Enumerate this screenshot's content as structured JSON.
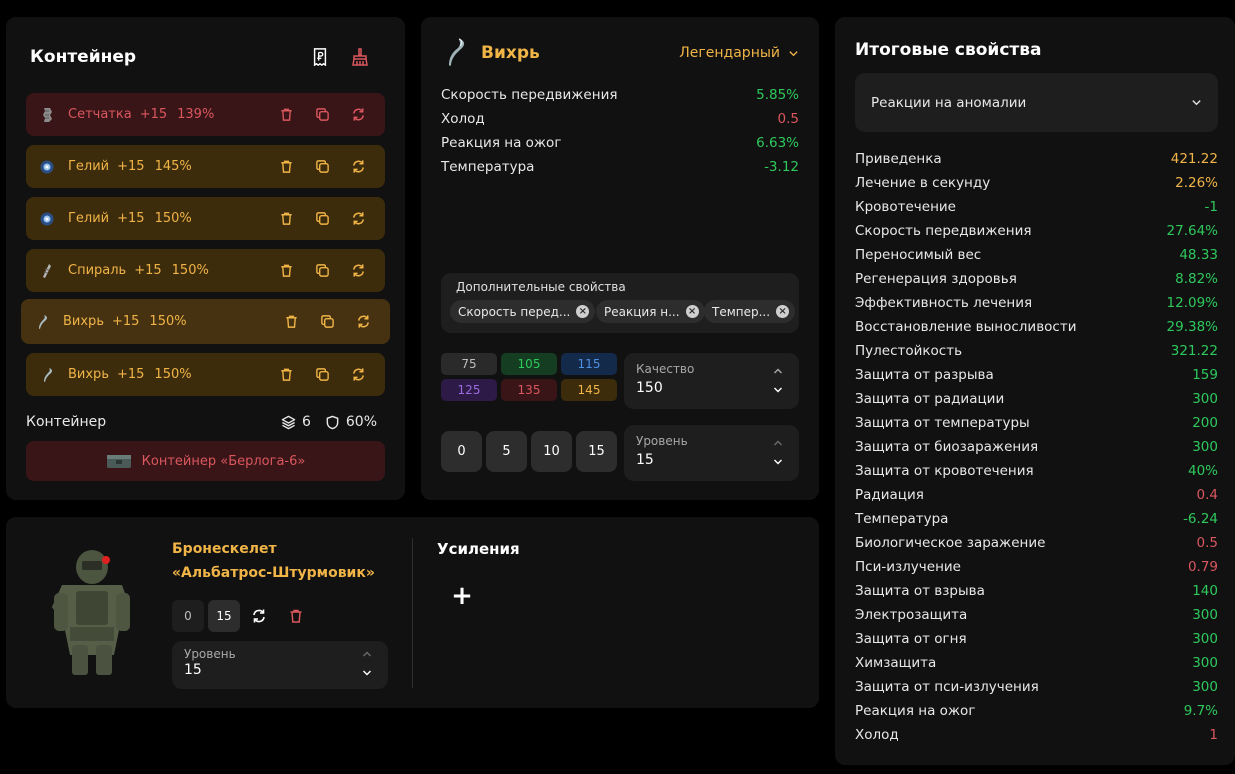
{
  "colors": {
    "green": "#2ec95c",
    "orange": "#f0b447",
    "red": "#d9575e",
    "panel": "#111111"
  },
  "container": {
    "title": "Контейнер",
    "header_icons": [
      "receipt-ruble-icon",
      "broom-icon"
    ],
    "slots": [
      {
        "name": "Сетчатка",
        "level": "+15",
        "quality": "139%",
        "tone": "red"
      },
      {
        "name": "Гелий",
        "level": "+15",
        "quality": "145%",
        "tone": "gold"
      },
      {
        "name": "Гелий",
        "level": "+15",
        "quality": "150%",
        "tone": "gold"
      },
      {
        "name": "Спираль",
        "level": "+15",
        "quality": "150%",
        "tone": "gold"
      },
      {
        "name": "Вихрь",
        "level": "+15",
        "quality": "150%",
        "tone": "gold",
        "active": true
      },
      {
        "name": "Вихрь",
        "level": "+15",
        "quality": "150%",
        "tone": "gold"
      }
    ],
    "footer_label": "Контейнер",
    "slots_count": "6",
    "protection": "60%",
    "selected": "Контейнер «Берлога-6»"
  },
  "artifact": {
    "name": "Вихрь",
    "rarity": "Легендарный",
    "properties": [
      {
        "label": "Скорость передвижения",
        "value": "5.85%",
        "tone": "g"
      },
      {
        "label": "Холод",
        "value": "0.5",
        "tone": "r"
      },
      {
        "label": "Реакция на ожог",
        "value": "6.63%",
        "tone": "g"
      },
      {
        "label": "Температура",
        "value": "-3.12",
        "tone": "g"
      }
    ],
    "extra_title": "Дополнительные свойства",
    "chips": [
      "Скорость перед...",
      "Реакция н...",
      "Темпер..."
    ],
    "quality_options": [
      {
        "label": "75",
        "bg": "#2a2a2a",
        "fg": "#bdbdbd"
      },
      {
        "label": "105",
        "bg": "#143d22",
        "fg": "#2ec95c"
      },
      {
        "label": "115",
        "bg": "#142a4a",
        "fg": "#4f8fe0"
      },
      {
        "label": "125",
        "bg": "#2e1a46",
        "fg": "#9b6be0"
      },
      {
        "label": "135",
        "bg": "#3a1518",
        "fg": "#d9575e"
      },
      {
        "label": "145",
        "bg": "#3d2c0c",
        "fg": "#f0b447"
      }
    ],
    "quality_label": "Качество",
    "quality_value": "150",
    "level_buttons": [
      "0",
      "5",
      "10",
      "15"
    ],
    "level_label": "Уровень",
    "level_value": "15"
  },
  "armor": {
    "name_line1": "Бронескелет",
    "name_line2": "«Альбатрос-Штурмовик»",
    "level_buttons": [
      "0",
      "15"
    ],
    "level_label": "Уровень",
    "level_value": "15",
    "boosts_title": "Усиления",
    "add_label": "+"
  },
  "totals": {
    "title": "Итоговые свойства",
    "dropdown": "Реакции на аномалии",
    "rows": [
      {
        "label": "Приведенка",
        "value": "421.22",
        "tone": "o"
      },
      {
        "label": "Лечение в секунду",
        "value": "2.26%",
        "tone": "o"
      },
      {
        "label": "Кровотечение",
        "value": "-1",
        "tone": "g"
      },
      {
        "label": "Скорость передвижения",
        "value": "27.64%",
        "tone": "g"
      },
      {
        "label": "Переносимый вес",
        "value": "48.33",
        "tone": "g"
      },
      {
        "label": "Регенерация здоровья",
        "value": "8.82%",
        "tone": "g"
      },
      {
        "label": "Эффективность лечения",
        "value": "12.09%",
        "tone": "g"
      },
      {
        "label": "Восстановление выносливости",
        "value": "29.38%",
        "tone": "g"
      },
      {
        "label": "Пулестойкость",
        "value": "321.22",
        "tone": "g"
      },
      {
        "label": "Защита от разрыва",
        "value": "159",
        "tone": "g"
      },
      {
        "label": "Защита от радиации",
        "value": "300",
        "tone": "g"
      },
      {
        "label": "Защита от температуры",
        "value": "200",
        "tone": "g"
      },
      {
        "label": "Защита от биозаражения",
        "value": "300",
        "tone": "g"
      },
      {
        "label": "Защита от кровотечения",
        "value": "40%",
        "tone": "g"
      },
      {
        "label": "Радиация",
        "value": "0.4",
        "tone": "r"
      },
      {
        "label": "Температура",
        "value": "-6.24",
        "tone": "g"
      },
      {
        "label": "Биологическое заражение",
        "value": "0.5",
        "tone": "r"
      },
      {
        "label": "Пси-излучение",
        "value": "0.79",
        "tone": "r"
      },
      {
        "label": "Защита от взрыва",
        "value": "140",
        "tone": "g"
      },
      {
        "label": "Электрозащита",
        "value": "300",
        "tone": "g"
      },
      {
        "label": "Защита от огня",
        "value": "300",
        "tone": "g"
      },
      {
        "label": "Химзащита",
        "value": "300",
        "tone": "g"
      },
      {
        "label": "Защита от пси-излучения",
        "value": "300",
        "tone": "g"
      },
      {
        "label": "Реакция на ожог",
        "value": "9.7%",
        "tone": "g"
      },
      {
        "label": "Холод",
        "value": "1",
        "tone": "r"
      }
    ]
  }
}
